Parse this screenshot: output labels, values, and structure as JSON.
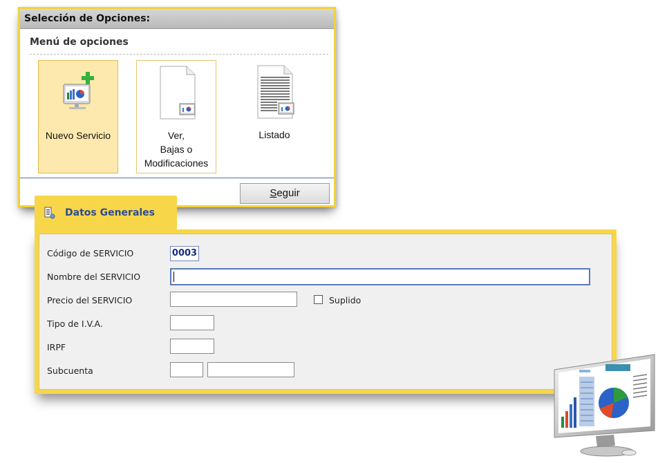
{
  "options_panel": {
    "title": "Selección de Opciones:",
    "menu_heading": "Menú de opciones",
    "items": [
      {
        "label": "Nuevo Servicio",
        "state": "selected",
        "icon": "monitor-add-icon"
      },
      {
        "label_lines": [
          "Ver,",
          "Bajas o",
          "Modificaciones"
        ],
        "state": "hover",
        "icon": "document-monitor-icon"
      },
      {
        "label": "Listado",
        "state": "normal",
        "icon": "list-document-icon"
      }
    ],
    "continue_button": {
      "accel": "S",
      "rest": "eguir"
    }
  },
  "datos_tab": {
    "label": "Datos Generales",
    "icon": "form-icon"
  },
  "form": {
    "codigo_label": "Código de SERVICIO",
    "codigo_value": "0003",
    "nombre_label": "Nombre del SERVICIO",
    "nombre_value": "",
    "precio_label": "Precio del SERVICIO",
    "precio_value": "",
    "suplido_label": "Suplido",
    "suplido_checked": false,
    "iva_label": "Tipo de I.V.A.",
    "iva_value": "",
    "irpf_label": "IRPF",
    "irpf_value": "",
    "subcuenta_label": "Subcuenta",
    "subcuenta_value_1": "",
    "subcuenta_value_2": ""
  },
  "colors": {
    "accent_yellow": "#f7d64a",
    "selected_card": "#fde9ad",
    "link_blue": "#2d4c92"
  }
}
